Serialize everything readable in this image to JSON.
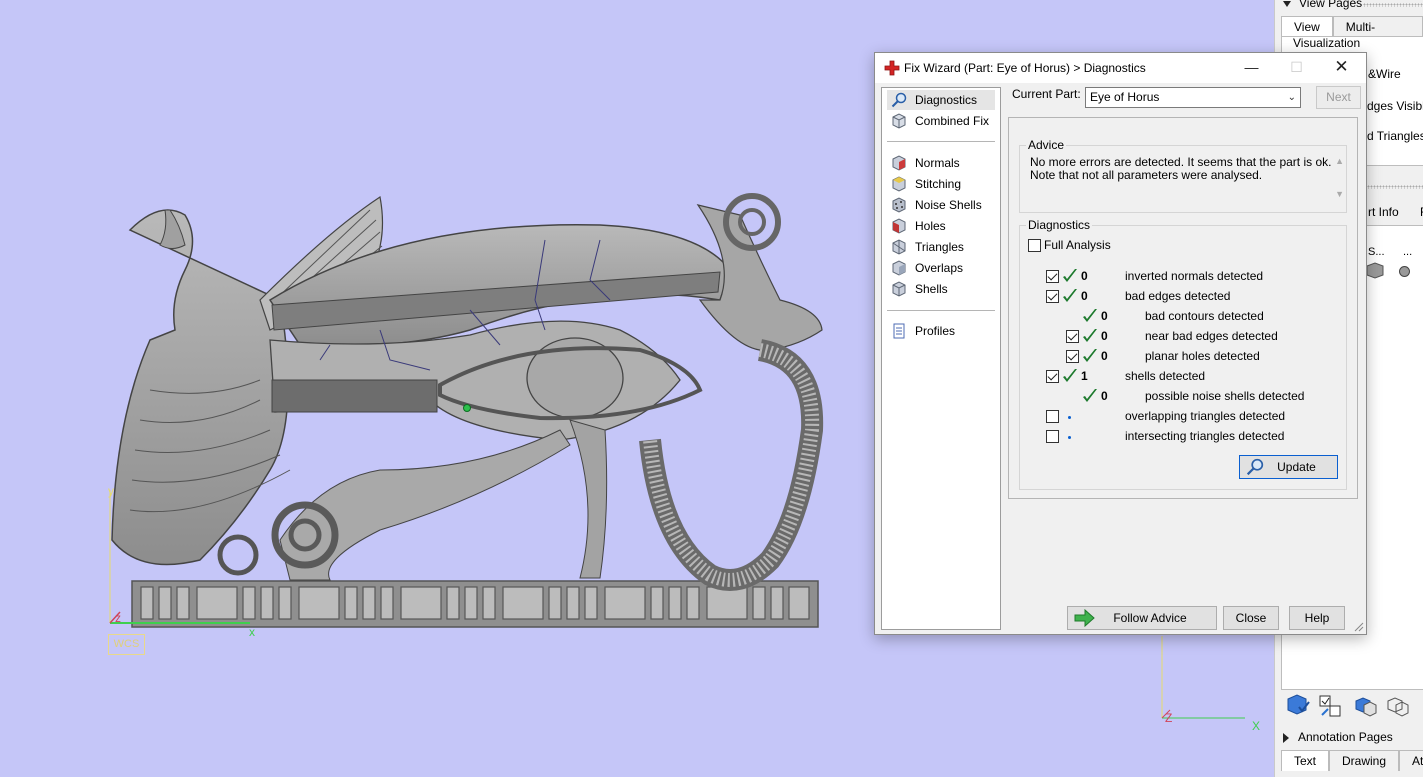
{
  "viewport": {
    "wcs_label": "WCS",
    "axis_y": "y",
    "axis_z": "z",
    "axis_x": "x",
    "axis2_z": "Z",
    "axis2_x": "X",
    "background_color": "#c5c6f8"
  },
  "side_panel": {
    "view_pages_header": "View Pages",
    "tabs": [
      "View",
      "Multi-Section"
    ],
    "visualization_label": "Visualization",
    "cut_texts": [
      "&Wire",
      "dges Visible",
      "d Triangles V",
      "rt Info",
      "F",
      "S...",
      "..."
    ],
    "annotation_pages_header": "Annotation Pages",
    "bottom_tabs": [
      "Text",
      "Drawing",
      "Att"
    ]
  },
  "dialog": {
    "title": "Fix Wizard (Part: Eye of Horus) > Diagnostics",
    "minimize_icon": "minimize-icon",
    "maximize_icon": "maximize-icon",
    "close_icon": "close-icon",
    "nav": {
      "group1": [
        {
          "label": "Diagnostics",
          "icon": "magnifier-icon",
          "selected": true
        },
        {
          "label": "Combined Fix",
          "icon": "cube-icon"
        }
      ],
      "group2": [
        {
          "label": "Normals",
          "icon": "normals-cube-icon"
        },
        {
          "label": "Stitching",
          "icon": "stitching-cube-icon"
        },
        {
          "label": "Noise Shells",
          "icon": "noise-shells-icon"
        },
        {
          "label": "Holes",
          "icon": "holes-cube-icon"
        },
        {
          "label": "Triangles",
          "icon": "triangles-cube-icon"
        },
        {
          "label": "Overlaps",
          "icon": "overlaps-cube-icon"
        },
        {
          "label": "Shells",
          "icon": "shells-cube-icon"
        }
      ],
      "group3": [
        {
          "label": "Profiles",
          "icon": "profiles-icon"
        }
      ]
    },
    "current_part_label": "Current Part:",
    "current_part_value": "Eye of Horus",
    "next_button": "Next",
    "advice": {
      "title": "Advice",
      "line1": "No more errors are detected. It seems that the part is ok.",
      "line2": "Note that not all parameters were analysed."
    },
    "diagnostics": {
      "title": "Diagnostics",
      "full_analysis_label": "Full Analysis",
      "full_analysis_checked": false,
      "rows": [
        {
          "checked": true,
          "status": "ok",
          "count": "0",
          "text": "inverted normals detected",
          "level": 0
        },
        {
          "checked": true,
          "status": "ok",
          "count": "0",
          "text": "bad edges detected",
          "level": 0
        },
        {
          "checked": null,
          "status": "ok",
          "count": "0",
          "text": "bad contours detected",
          "level": 1
        },
        {
          "checked": true,
          "status": "ok",
          "count": "0",
          "text": "near bad edges detected",
          "level": 1
        },
        {
          "checked": true,
          "status": "ok",
          "count": "0",
          "text": "planar holes detected",
          "level": 1
        },
        {
          "checked": true,
          "status": "ok",
          "count": "1",
          "text": "shells detected",
          "level": 0
        },
        {
          "checked": null,
          "status": "ok",
          "count": "0",
          "text": "possible noise shells detected",
          "level": 1
        },
        {
          "checked": false,
          "status": "none",
          "count": "",
          "text": "overlapping triangles detected",
          "level": 0
        },
        {
          "checked": false,
          "status": "none",
          "count": "",
          "text": "intersecting triangles detected",
          "level": 0
        }
      ],
      "update_button": "Update"
    },
    "follow_advice_button": "Follow Advice",
    "close_button": "Close",
    "help_button": "Help",
    "tick_color": "#1e7a2e",
    "accent_color": "#0a5fd0"
  }
}
